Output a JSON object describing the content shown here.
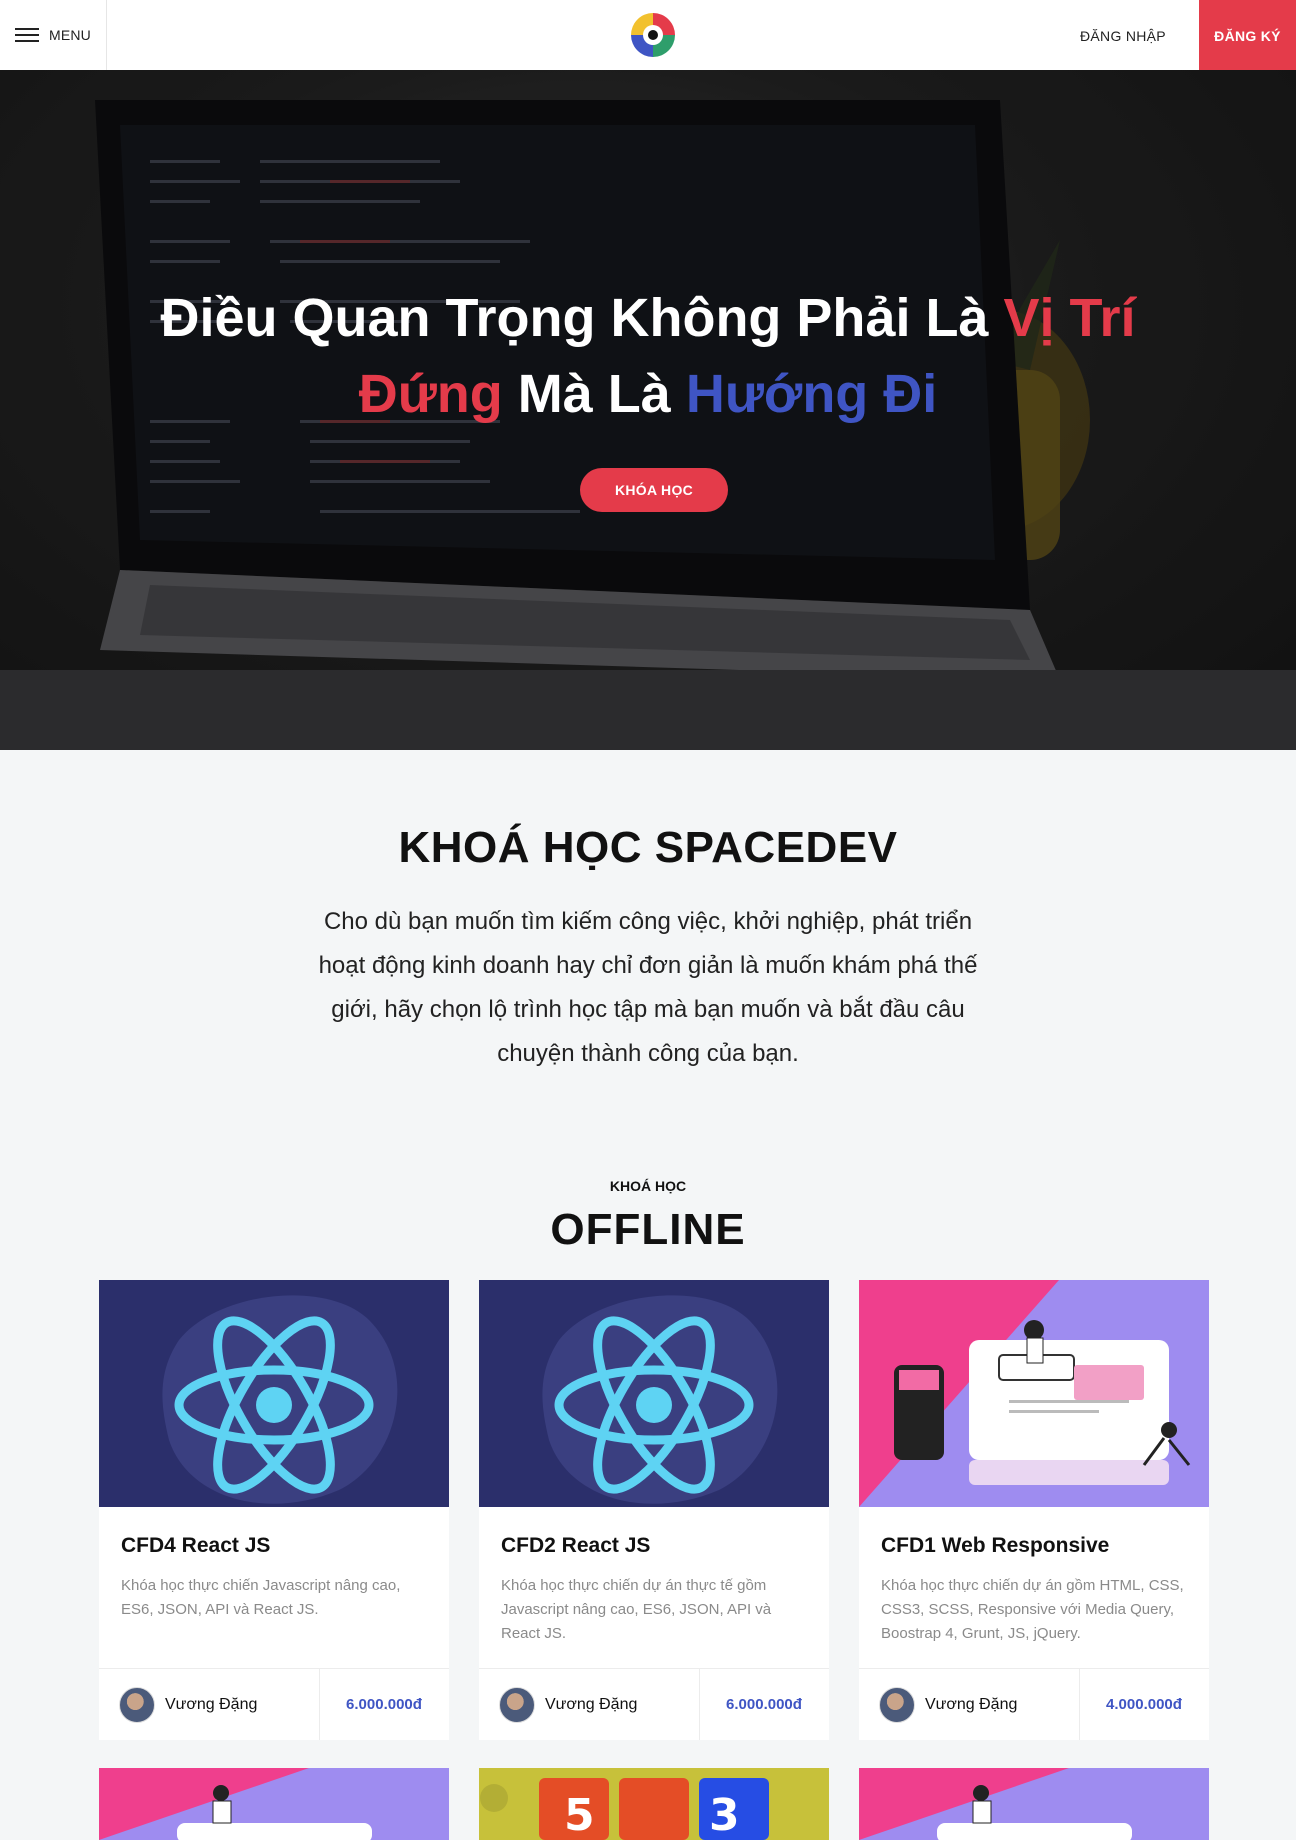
{
  "header": {
    "menu_label": "MENU",
    "login_label": "ĐĂNG NHẬP",
    "register_label": "ĐĂNG KÝ"
  },
  "hero": {
    "title_part1": "Điều Quan Trọng Không Phải Là ",
    "title_part2": "Vị Trí",
    "title_part3": "Đứng",
    "title_part4": " Mà Là ",
    "title_part5": "Hướng Đi",
    "button_label": "KHÓA HỌC"
  },
  "about": {
    "title": "KHOÁ HỌC SPACEDEV",
    "description": "Cho dù bạn muốn tìm kiếm công việc, khởi nghiệp, phát triển hoạt động kinh doanh hay chỉ đơn giản là muốn khám phá thế giới, hãy chọn lộ trình học tập mà bạn muốn và bắt đầu câu chuyện thành công của bạn."
  },
  "courses": {
    "subtitle": "KHOÁ HỌC",
    "title": "OFFLINE",
    "items": [
      {
        "title": "CFD4 React JS",
        "description": "Khóa học thực chiến Javascript nâng cao, ES6, JSON, API và React JS.",
        "author": "Vương Đặng",
        "price": "6.000.000đ",
        "image": "react-icon"
      },
      {
        "title": "CFD2 React JS",
        "description": "Khóa học thực chiến dự án thực tế gồm Javascript nâng cao, ES6, JSON, API và React JS.",
        "author": "Vương Đặng",
        "price": "6.000.000đ",
        "image": "react-icon"
      },
      {
        "title": "CFD1 Web Responsive",
        "description": "Khóa học thực chiến dự án gồm HTML, CSS, CSS3, SCSS, Responsive với Media Query, Boostrap 4, Grunt, JS, jQuery.",
        "author": "Vương Đặng",
        "price": "4.000.000đ",
        "image": "web-design-illustration"
      }
    ]
  },
  "colors": {
    "accent_red": "#e43b4a",
    "accent_blue": "#3f55c4",
    "react_bg": "#2b2f6b",
    "react_cyan": "#5ed3f3"
  }
}
